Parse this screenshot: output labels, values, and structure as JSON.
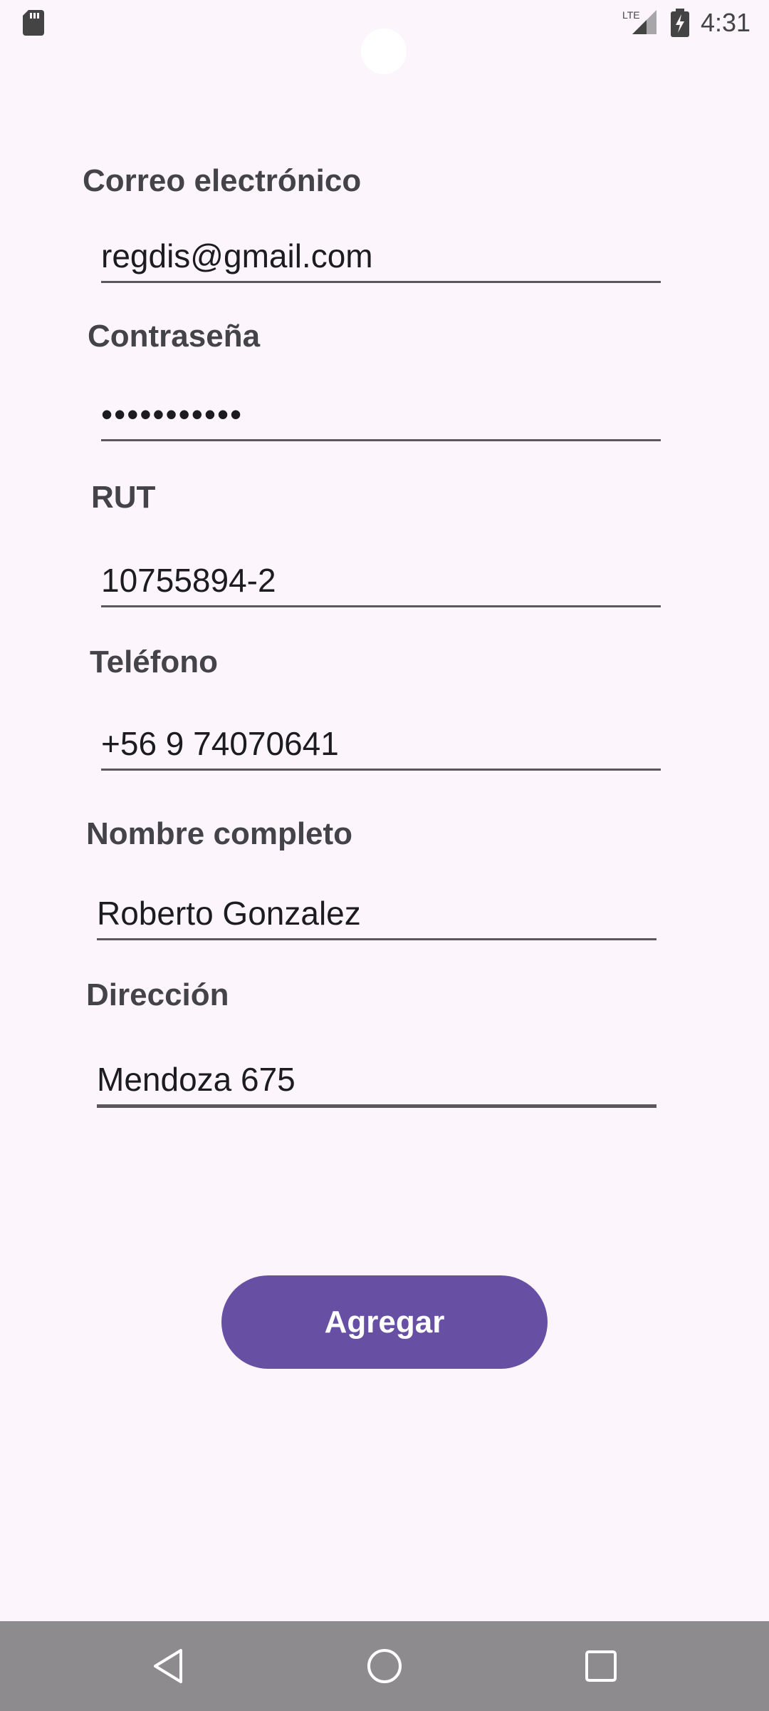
{
  "status_bar": {
    "network_label": "LTE",
    "time": "4:31"
  },
  "form": {
    "email": {
      "label": "Correo electrónico",
      "value": "regdis@gmail.com"
    },
    "password": {
      "label": "Contraseña",
      "value": "•••••••••••"
    },
    "rut": {
      "label": "RUT",
      "value": "10755894-2"
    },
    "phone": {
      "label": "Teléfono",
      "value": "+56 9 74070641"
    },
    "full_name": {
      "label": "Nombre completo",
      "value": "Roberto Gonzalez"
    },
    "address": {
      "label": "Dirección",
      "value": "Mendoza 675"
    }
  },
  "actions": {
    "submit_label": "Agregar"
  },
  "colors": {
    "background": "#fcf6fc",
    "accent": "#6750a4",
    "nav_bar": "#8e8b8f"
  },
  "icons": {
    "status": [
      "sd-card-icon",
      "lte-signal-icon",
      "battery-charging-icon"
    ],
    "navigation": [
      "back-icon",
      "home-icon",
      "recents-icon"
    ]
  }
}
